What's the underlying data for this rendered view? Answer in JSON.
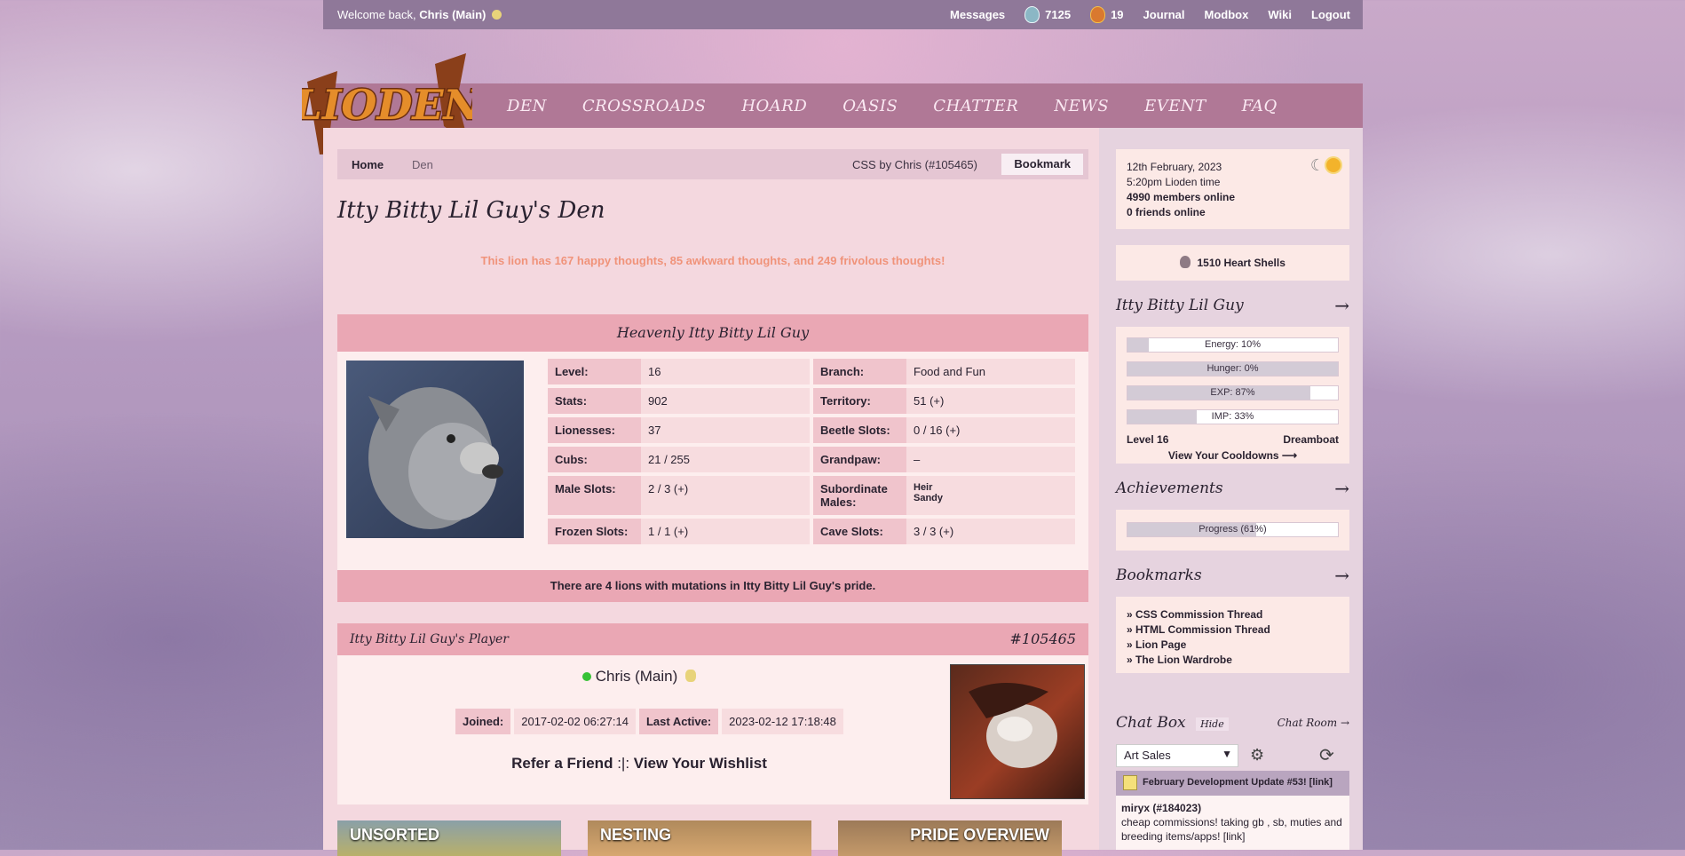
{
  "topbar": {
    "welcome_prefix": "Welcome back,",
    "user": "Chris (Main)",
    "messages": "Messages",
    "currency_a": "7125",
    "currency_b": "19",
    "journal": "Journal",
    "modbox": "Modbox",
    "wiki": "Wiki",
    "logout": "Logout"
  },
  "logo_text": "LIODEN",
  "nav": [
    "DEN",
    "CROSSROADS",
    "HOARD",
    "OASIS",
    "CHATTER",
    "NEWS",
    "EVENT",
    "FAQ"
  ],
  "breadcrumb": {
    "home": "Home",
    "den": "Den",
    "credit": "CSS by Chris (#105465)",
    "bookmark": "Bookmark"
  },
  "page_title": "Itty Bitty Lil Guy's Den",
  "thoughts": "This lion has 167 happy thoughts, 85 awkward thoughts, and 249 frivolous thoughts!",
  "lion": {
    "header": "Heavenly Itty Bitty Lil Guy",
    "stats": [
      [
        {
          "k": "Level:",
          "v": "16"
        },
        {
          "k": "Branch:",
          "v": "Food and Fun"
        }
      ],
      [
        {
          "k": "Stats:",
          "v": "902"
        },
        {
          "k": "Territory:",
          "v": "51 (+)"
        }
      ],
      [
        {
          "k": "Lionesses:",
          "v": "37"
        },
        {
          "k": "Beetle Slots:",
          "v": "0 / 16 (+)"
        }
      ],
      [
        {
          "k": "Cubs:",
          "v": "21 / 255"
        },
        {
          "k": "Grandpaw:",
          "v": "–"
        }
      ],
      [
        {
          "k": "Male Slots:",
          "v": "2 / 3 (+)"
        },
        {
          "k": "Subordinate Males:",
          "v": "Heir\nSandy"
        }
      ],
      [
        {
          "k": "Frozen Slots:",
          "v": "1 / 1 (+)"
        },
        {
          "k": "Cave Slots:",
          "v": "3 / 3 (+)"
        }
      ]
    ],
    "mutations": "There are 4 lions with mutations in Itty Bitty Lil Guy's pride."
  },
  "player": {
    "header": "Itty Bitty Lil Guy's Player",
    "id": "#105465",
    "name": "Chris (Main)",
    "joined_label": "Joined:",
    "joined": "2017-02-02 06:27:14",
    "active_label": "Last Active:",
    "active": "2023-02-12 17:18:48",
    "refer": "Refer a Friend",
    "sep": ":|:",
    "wishlist": "View Your Wishlist"
  },
  "tiles": [
    "UNSORTED",
    "NESTING",
    "PRIDE OVERVIEW"
  ],
  "sidebar": {
    "date": "12th February, 2023",
    "time": "5:20pm Lioden time",
    "members": "4990 members online",
    "friends": "0 friends online",
    "heart_shells": "1510 Heart Shells",
    "lion_title": "Itty Bitty Lil Guy",
    "bars": [
      {
        "label": "Energy: 10%",
        "pct": 10
      },
      {
        "label": "Hunger: 0%",
        "pct": 100
      },
      {
        "label": "EXP: 87%",
        "pct": 87
      },
      {
        "label": "IMP: 33%",
        "pct": 33
      }
    ],
    "level": "Level 16",
    "status": "Dreamboat",
    "cooldowns": "View Your Cooldowns ⟶",
    "achievements_title": "Achievements",
    "progress": {
      "label": "Progress (61%)",
      "pct": 61
    },
    "bookmarks_title": "Bookmarks",
    "bookmarks": [
      "CSS Commission Thread",
      "HTML Commission Thread",
      "Lion Page",
      "The Lion Wardrobe"
    ],
    "chat_title": "Chat Box",
    "hide": "Hide",
    "chat_room": "Chat Room →",
    "chat_select": "Art Sales",
    "announcement": "February Development Update #53! [link]",
    "msg_user": "miryx (#184023)",
    "msg_text": "cheap commissions! taking gb , sb, muties and breeding items/apps! [link]"
  },
  "colors": {
    "topbar": "#8f7899",
    "nav": "#b07896",
    "accent": "#eaa7b4",
    "thoughts": "#f0937a"
  }
}
